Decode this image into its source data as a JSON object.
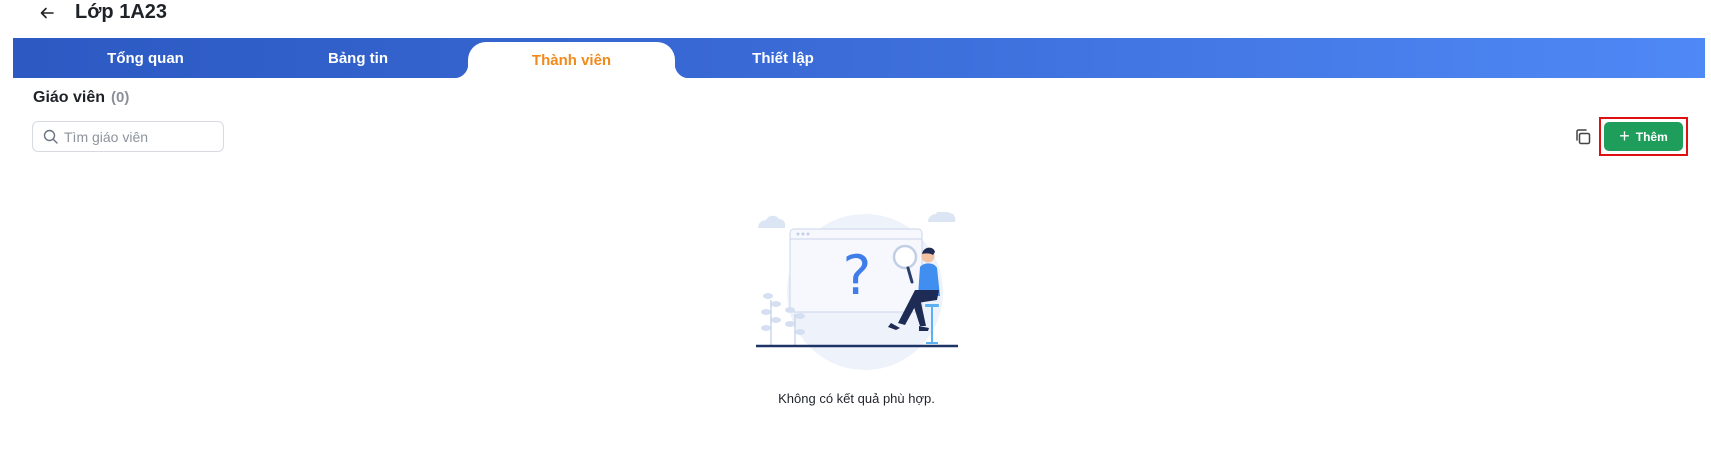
{
  "header": {
    "title": "Lớp 1A23",
    "back_icon": "arrow-left-icon"
  },
  "tabs": [
    {
      "label": "Tổng quan",
      "active": false
    },
    {
      "label": "Bảng tin",
      "active": false
    },
    {
      "label": "Thành viên",
      "active": true
    },
    {
      "label": "Thiết lập",
      "active": false
    }
  ],
  "section": {
    "title": "Giáo viên",
    "count": "(0)"
  },
  "search": {
    "placeholder": "Tìm giáo viên",
    "value": ""
  },
  "actions": {
    "copy_icon": "copy-icon",
    "add_label": "Thêm",
    "add_icon": "plus-icon",
    "add_color": "#1f9d5a",
    "highlight_color": "#e01010"
  },
  "empty_state": {
    "message": "Không có kết quả phù hợp."
  },
  "colors": {
    "tabbar_start": "#2c59c2",
    "tabbar_end": "#4f89f6",
    "active_tab_text": "#f08a1c"
  }
}
